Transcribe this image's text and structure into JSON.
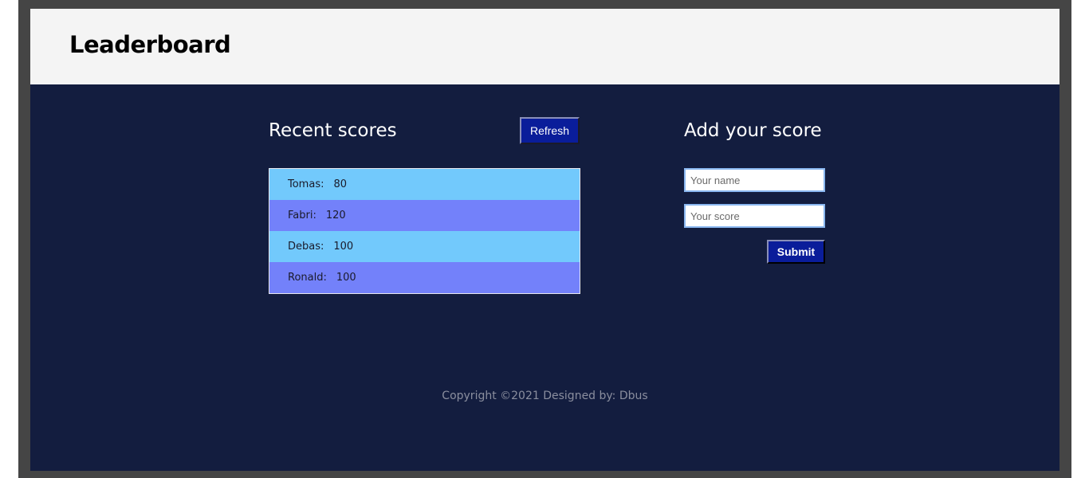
{
  "header": {
    "title": "Leaderboard"
  },
  "recent": {
    "title": "Recent scores",
    "refresh_label": "Refresh",
    "scores": [
      {
        "name": "Tomas:",
        "score": "80"
      },
      {
        "name": "Fabri:",
        "score": "120"
      },
      {
        "name": "Debas:",
        "score": "100"
      },
      {
        "name": "Ronald:",
        "score": "100"
      }
    ]
  },
  "add": {
    "title": "Add your score",
    "name_placeholder": "Your name",
    "score_placeholder": "Your score",
    "submit_label": "Submit"
  },
  "footer": {
    "text": "Copyright ©2021  Designed by: Dbus"
  },
  "colors": {
    "background": "#131d3f",
    "header": "#f4f4f4",
    "row_odd": "#72c9fc",
    "row_even": "#7381fa",
    "button": "#0a1d9a"
  }
}
